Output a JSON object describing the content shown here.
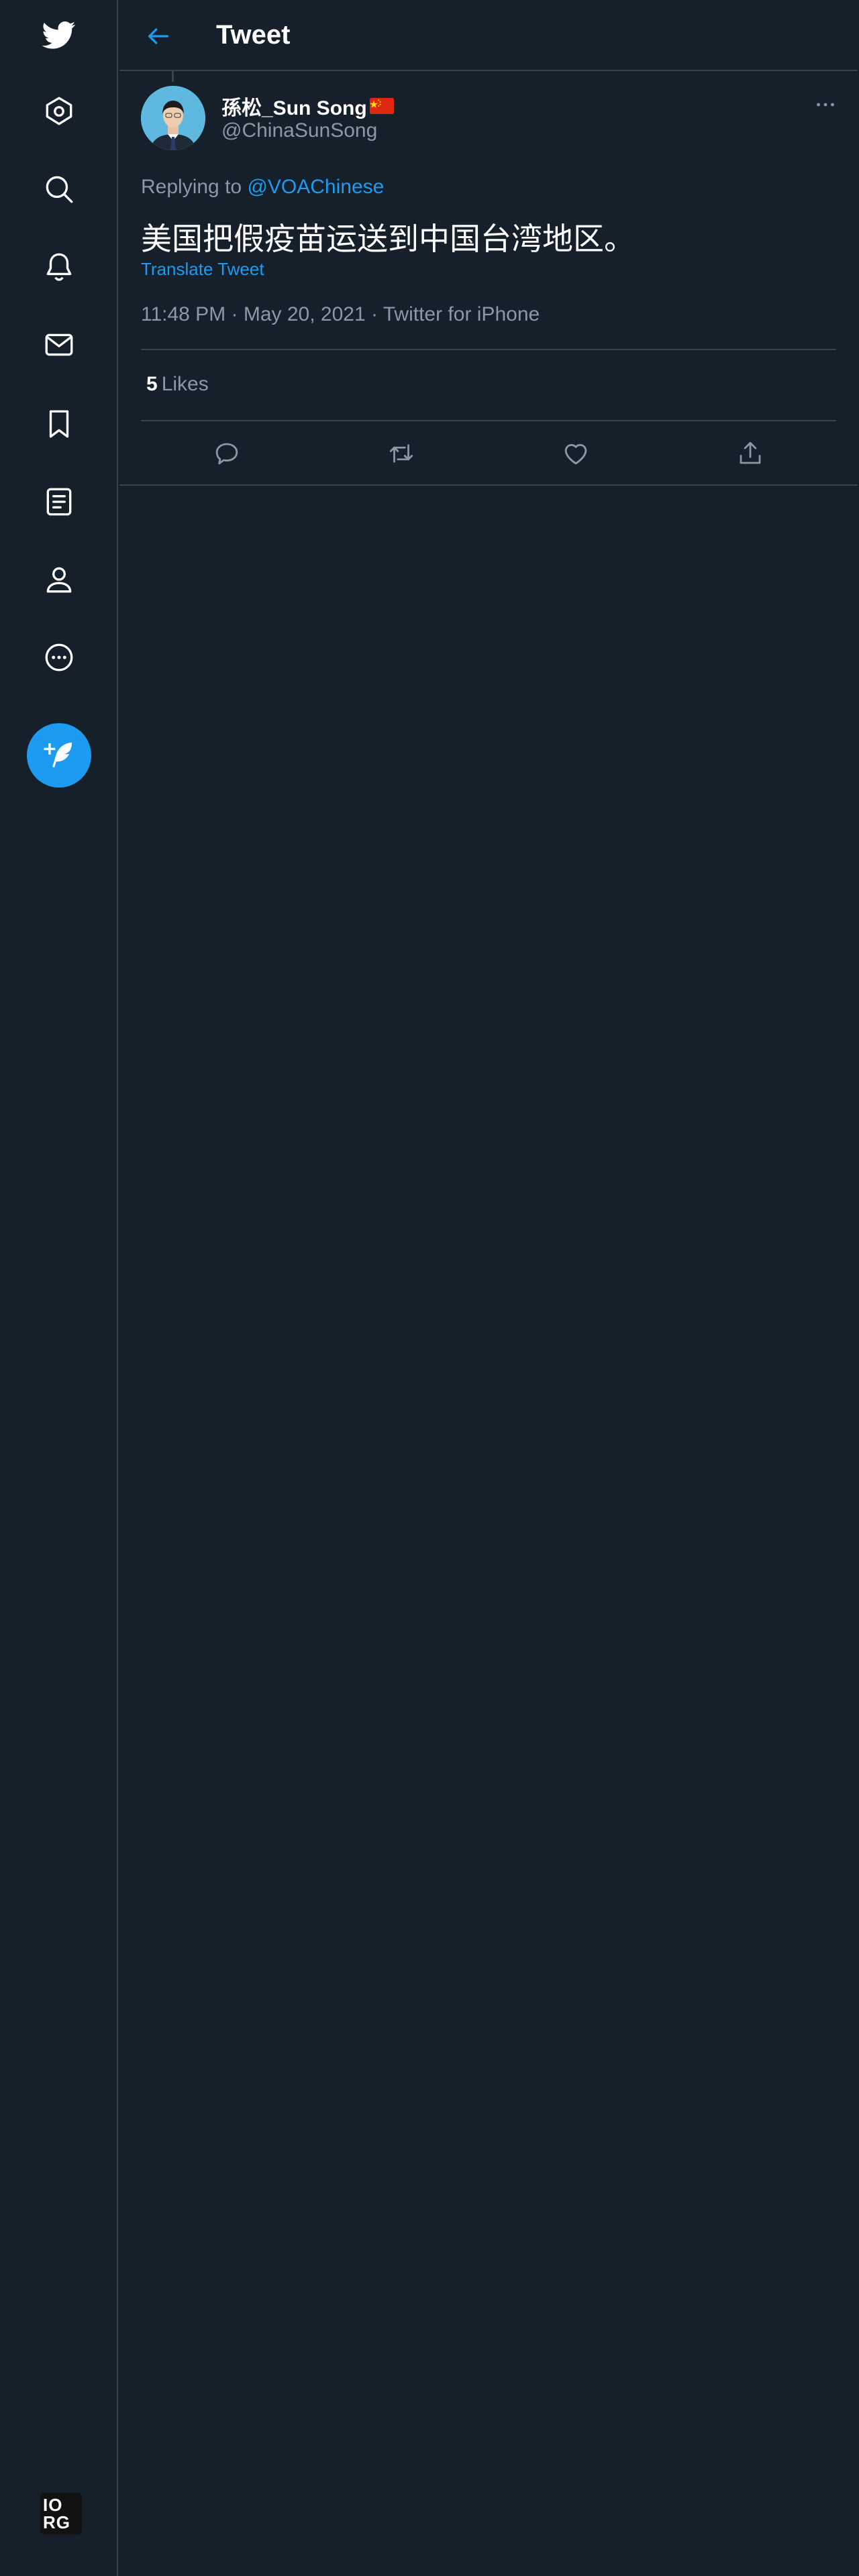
{
  "header": {
    "title": "Tweet"
  },
  "nav": {
    "items": [
      {
        "name": "home"
      },
      {
        "name": "explore"
      },
      {
        "name": "notifications"
      },
      {
        "name": "messages"
      },
      {
        "name": "bookmarks"
      },
      {
        "name": "lists"
      },
      {
        "name": "profile"
      },
      {
        "name": "more"
      }
    ],
    "footer_logo_line1": "IO",
    "footer_logo_line2": "RG"
  },
  "tweet": {
    "display_name": "孫松_Sun Song",
    "handle": "@ChinaSunSong",
    "replying_prefix": "Replying to",
    "replying_to": "@VOAChinese",
    "text": "美国把假疫苗运送到中国台湾地区。",
    "translate_label": "Translate Tweet",
    "meta": "11:48 PM · May 20, 2021 · Twitter for iPhone",
    "likes_count": "5",
    "likes_label": "Likes"
  },
  "colors": {
    "background": "#15202b",
    "border": "#38444d",
    "accent": "#1d9bf0",
    "secondary_text": "#8b98a5",
    "primary_text": "#ffffff"
  }
}
